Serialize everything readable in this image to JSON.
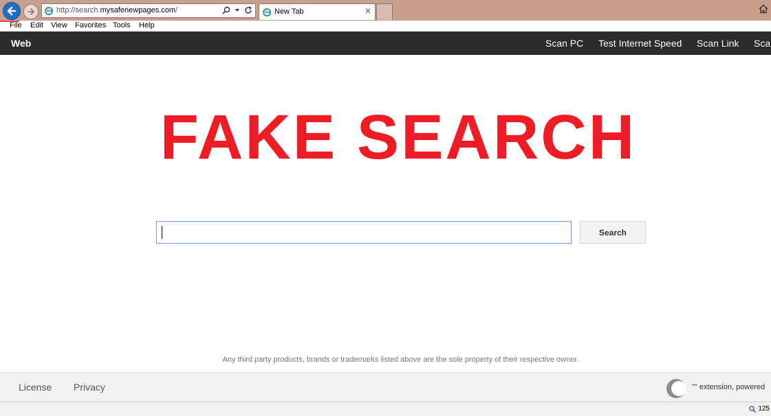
{
  "browser": {
    "address_prefix": "http://search.",
    "address_domain": "mysafenewpages.com",
    "address_suffix": "/",
    "tab_title": "New Tab",
    "tab_close": "✕",
    "menu": [
      "File",
      "Edit",
      "View",
      "Favorites",
      "Tools",
      "Help"
    ],
    "zoom_label": "125"
  },
  "site": {
    "brand": "Web",
    "nav": [
      "Scan PC",
      "Test Internet Speed",
      "Scan Link",
      "Sca"
    ]
  },
  "main": {
    "overlay_title": "FAKE SEARCH",
    "search_value": "",
    "search_button": "Search",
    "disclaimer": "Any third party products, brands or trademarks listed above are the sole property of their respective owner."
  },
  "footer": {
    "links": [
      "License",
      "Privacy"
    ],
    "extension_text": "\"\" extension, powered"
  },
  "colors": {
    "overlay": "#ee1c24",
    "nav_bg": "#2b2b2b",
    "chrome": "#c89e8c"
  },
  "icons": [
    "back-arrow-icon",
    "forward-arrow-icon",
    "ie-logo-icon",
    "search-icon",
    "dropdown-icon",
    "refresh-icon",
    "close-icon",
    "home-icon",
    "zoom-icon",
    "extension-logo-icon"
  ]
}
